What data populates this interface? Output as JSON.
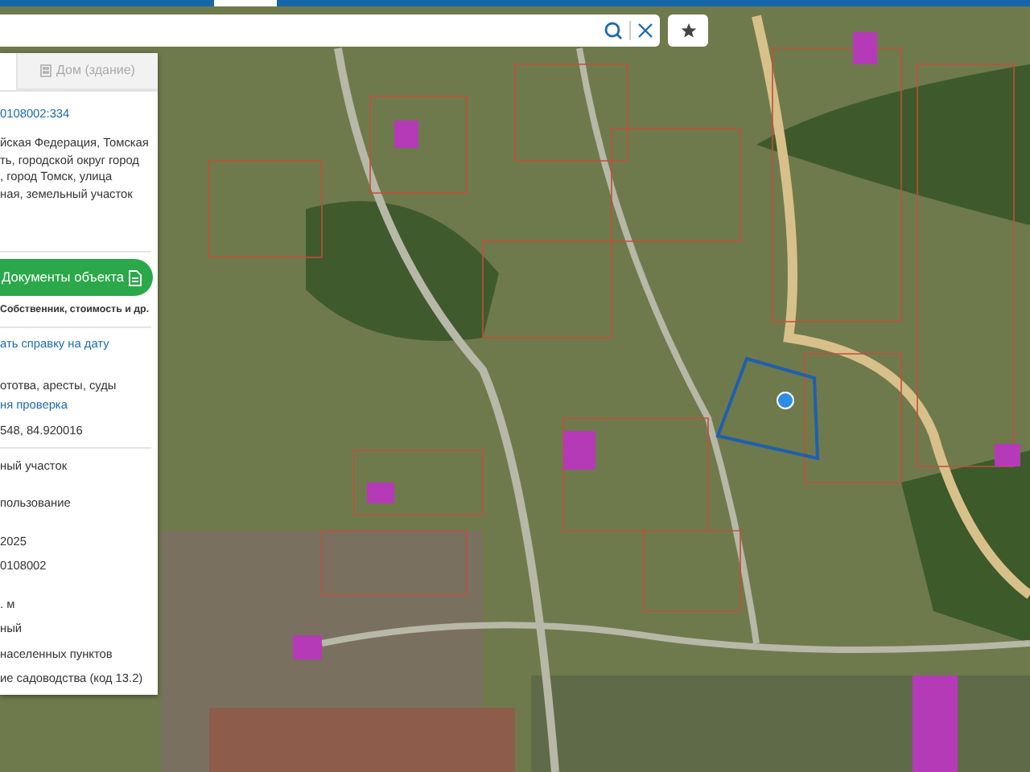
{
  "panel": {
    "tabs": [
      {
        "label": "Дом (здание)",
        "selected": false
      }
    ],
    "cadastral_number": "0108002:334",
    "address_lines": [
      "йская Федерация, Томская",
      "ть, городской округ город",
      ", город Томск, улица",
      "ная, земельный участок"
    ],
    "documents_button": "Документы объекта",
    "documents_note": "Собственник, стоимость и др.",
    "report_link": "ать справку на дату",
    "checks_text": "ототва, аресты, суды",
    "checks_link": "ня проверка",
    "coordinates": "548, 84.920016",
    "details": [
      "ный участок",
      "пользование",
      "2025",
      "0108002",
      ". м",
      "ный",
      " населенных пунктов",
      "ие садоводства (код 13.2)"
    ]
  }
}
